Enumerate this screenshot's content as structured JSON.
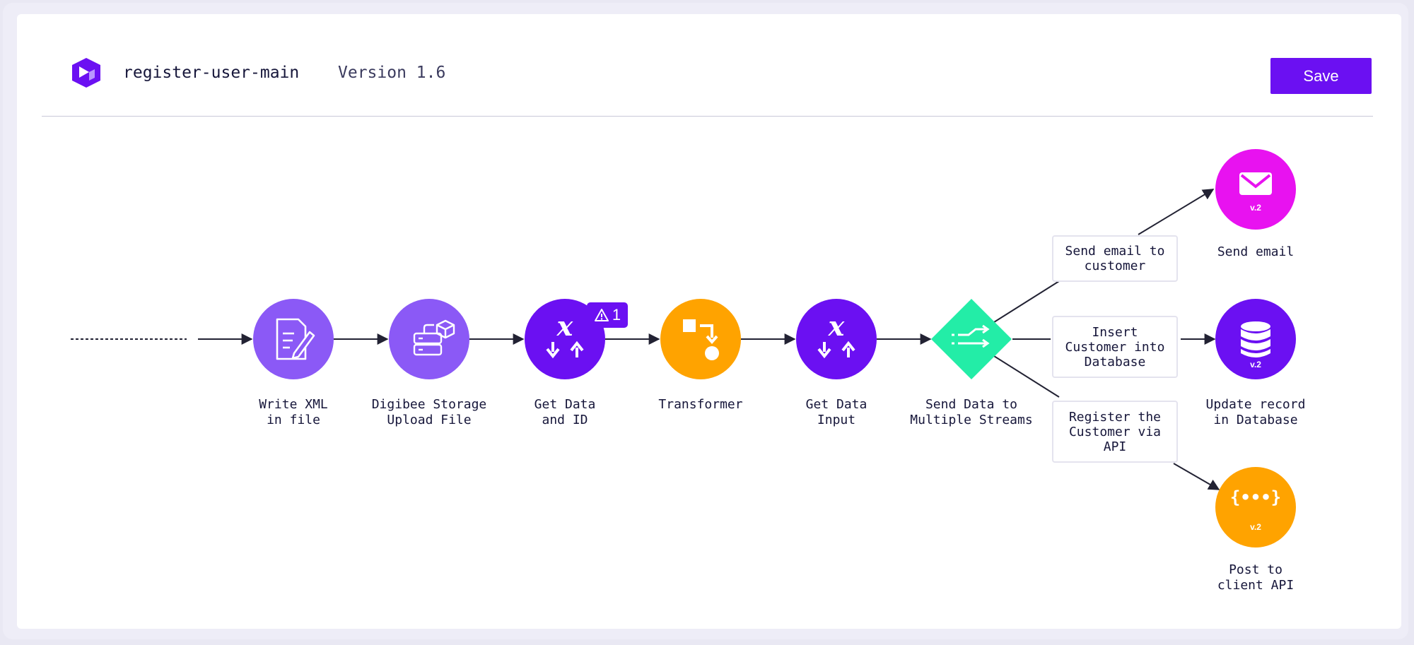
{
  "header": {
    "flow_name": "register-user-main",
    "version": "Version 1.6",
    "save_label": "Save"
  },
  "steps": [
    {
      "label": "Write XML\nin file",
      "icon": "document-edit-icon",
      "color": "#8b59f6"
    },
    {
      "label": "Digibee Storage\nUpload File",
      "icon": "storage-upload-icon",
      "color": "#8b59f6"
    },
    {
      "label": "Get Data\nand ID",
      "icon": "variable-exchange-icon",
      "color": "#6b10f2"
    },
    {
      "label": "Transformer",
      "icon": "transformer-icon",
      "color": "#ffa300"
    },
    {
      "label": "Get Data\nInput",
      "icon": "variable-exchange-icon",
      "color": "#6b10f2"
    },
    {
      "label": "Send Data to\nMultiple Streams",
      "icon": "split-streams-icon",
      "color": "#23eda7"
    }
  ],
  "warning_badge": {
    "icon": "warning-icon",
    "count": "1"
  },
  "branches": [
    {
      "label": "Send email to\ncustomer"
    },
    {
      "label": "Insert\nCustomer into\nDatabase"
    },
    {
      "label": "Register the\nCustomer via\nAPI"
    }
  ],
  "targets": [
    {
      "label": "Send email",
      "icon": "mail-icon",
      "version": "v.2",
      "color": "#e812f0"
    },
    {
      "label": "Update record\nin Database",
      "icon": "database-icon",
      "version": "v.2",
      "color": "#6b10f2"
    },
    {
      "label": "Post to\nclient API",
      "icon": "api-icon",
      "version": "v.2",
      "color": "#ffa300"
    }
  ],
  "colors": {
    "brand": "#6b10f2",
    "line": "#222233",
    "text": "#16163a"
  }
}
